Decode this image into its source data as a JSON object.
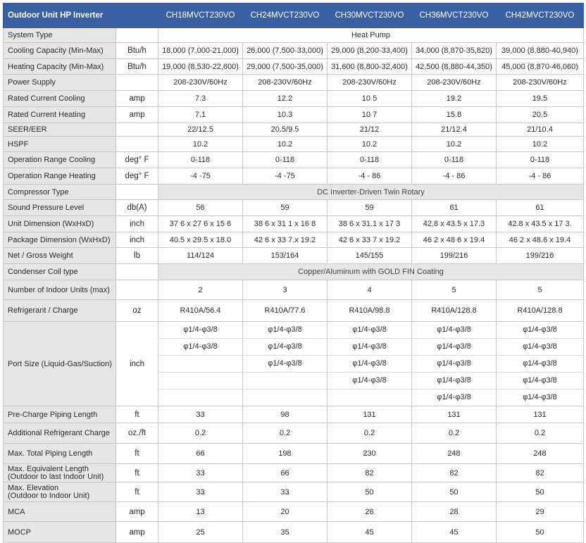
{
  "table": {
    "title": "Outdoor Unit HP Inverter",
    "models": [
      "CH18MVCT230VO",
      "CH24MVCT230VO",
      "CH30MVCT230VO",
      "CH36MVCT230VO",
      "CH42MVCT230VO"
    ],
    "rows": [
      {
        "label": "System Type",
        "unit": "",
        "span": "Heat Pump",
        "height": 21
      },
      {
        "label": "Cooling Capacity (Min-Max)",
        "unit": "Btu/h",
        "values": [
          "18,000 (7,000-21,000)",
          "26,000 (7,500-33,000)",
          "29,000 (8,200-33,400)",
          "34,000 (8,870-35,820)",
          "39,000 (8,880-40,940)"
        ],
        "height": 23
      },
      {
        "label": "Heating Capacity (Min-Max)",
        "unit": "Btu/h",
        "values": [
          "19,000 (8,530-22,600)",
          "29,000 (7,500-35,000)",
          "31,600 (8,800-32,400)",
          "42,500 (8,880-44,350)",
          "45,000 (8,870-46,060)"
        ],
        "height": 22
      },
      {
        "label": "Power Supply",
        "unit": "",
        "values": [
          "208-230V/60Hz",
          "208-230V/60Hz",
          "208-230V/60Hz",
          "208-230V/60Hz",
          "208-230V/60Hz"
        ],
        "height": 23
      },
      {
        "label": "Rated  Current  Cooling",
        "unit": "amp",
        "values": [
          "7.3",
          "12.2",
          "10 5",
          "19.2",
          "19.5"
        ],
        "height": 23
      },
      {
        "label": "Rated  Current  Heating",
        "unit": "amp",
        "values": [
          "7.1",
          "10.3",
          "10 7",
          "15.8",
          "20.5"
        ],
        "height": 23
      },
      {
        "label": "SEER/EER",
        "unit": "",
        "values": [
          "22/12.5",
          "20.5/9.5",
          "21/12",
          "21/12.4",
          "21/10.4"
        ],
        "height": 19
      },
      {
        "label": "HSPF",
        "unit": "",
        "values": [
          "10.2",
          "10.2",
          "10.2",
          "10.2",
          "10.2"
        ],
        "height": 22
      },
      {
        "label": "Operation Range  Cooling",
        "unit": "deg° F",
        "values": [
          "0-118",
          "0-118",
          "0-118",
          "0-118",
          "0-118"
        ],
        "height": 23
      },
      {
        "label": "Operation Range  Heating",
        "unit": "deg° F",
        "values": [
          "-4 -75",
          "-4 -75",
          "-4 - 86",
          "-4 - 86",
          "-4 - 86"
        ],
        "height": 23
      },
      {
        "label": "Compressor Type",
        "unit": "",
        "span": "DC Inverter-Driven Twin Rotary",
        "shaded": true,
        "height": 22
      },
      {
        "label": "Sound Pressure Level",
        "unit": "db(A)",
        "values": [
          "56",
          "59",
          "59",
          "61",
          "61"
        ],
        "height": 23
      },
      {
        "label": "Unit Dimension (WxHxD)",
        "unit": "inch",
        "values": [
          "37 6 x 27 6 x 15 6",
          "38 6 x 31 1 x 16 8",
          "38 6 x 31.1 x 17 3",
          "42.8 x 43.5 x 17.3",
          "42.8 x 43.5 x 17 3."
        ],
        "height": 23
      },
      {
        "label": "Package Dimension (WxHxD)",
        "unit": "inch",
        "values": [
          "40.5 x 29.5 x 18.0",
          "42 6 x 33 7.x 19.2",
          "42 6 x 33 7 x 19.2",
          "46 2 x 48 6 x 19.4",
          "46 2 x 48.6 x 19.4"
        ],
        "height": 22
      },
      {
        "label": "Net / Gross Weight",
        "unit": "lb",
        "values": [
          "114/124",
          "153/164",
          "145/155",
          "199/216",
          "199/216"
        ],
        "height": 23
      },
      {
        "label": "Condenser Coil type",
        "unit": "",
        "span": "Copper/Aluminum with GOLD FIN Coating",
        "shaded": true,
        "height": 23
      },
      {
        "label": "Number of Indoor Units (max)",
        "unit": "",
        "values": [
          "2",
          "3",
          "4",
          "5",
          "5"
        ],
        "height": 28
      },
      {
        "label": "Refrigerant / Charge",
        "unit": "oz",
        "values": [
          "R410A/56.4",
          "R410A/77.6",
          "R410A/98.8",
          "R410A/128.8",
          "R410A/128.8"
        ],
        "height": 31
      },
      {
        "label": "Port Size (Liquid-Gas/Suction)",
        "unit": "inch",
        "ports": [
          [
            "φ1/4-φ3/8",
            "φ1/4-φ3/8",
            "",
            "",
            ""
          ],
          [
            "φ1/4-φ3/8",
            "φ1/4-φ3/8",
            "φ1/4-φ3/8",
            "",
            ""
          ],
          [
            "φ1/4-φ3/8",
            "φ1/4-φ3/8",
            "φ1/4-φ3/8",
            "φ1/4-φ3/8",
            ""
          ],
          [
            "φ1/4-φ3/8",
            "φ1/4-φ3/8",
            "φ1/4-φ3/8",
            "φ1/4-φ3/8",
            "φ1/4-φ3/8"
          ],
          [
            "φ1/4-φ3/8",
            "φ1/4-φ3/8",
            "φ1/4-φ3/8",
            "φ1/4-φ3/8",
            "φ1/4-φ3/8"
          ]
        ],
        "height": 115
      },
      {
        "label": "Pre-Charge Piping Length",
        "unit": "ft",
        "values": [
          "33",
          "98",
          "131",
          "131",
          "131"
        ],
        "height": 24
      },
      {
        "label": "Additional Refrigerant Charge",
        "unit": "oz./ft",
        "values": [
          "0.2",
          "0.2",
          "0.2",
          "0.2",
          "0.2"
        ],
        "height": 29
      },
      {
        "label": "Max. Total Piping Length",
        "unit": "ft",
        "values": [
          "66",
          "198",
          "230",
          "248",
          "248"
        ],
        "height": 29
      },
      {
        "label": "Max. Equivalent Length\n(Outdoor to last Indoor Unit)",
        "unit": "ft",
        "values": [
          "33",
          "66",
          "82",
          "82",
          "82"
        ],
        "height": 26,
        "twoLine": true
      },
      {
        "label": "Max. Elevation\n(Outdoor to Indoor Unit)",
        "unit": "ft",
        "values": [
          "33",
          "33",
          "50",
          "50",
          "50"
        ],
        "height": 28,
        "twoLine": true
      },
      {
        "label": "MCA",
        "unit": "amp",
        "values": [
          "13",
          "20",
          "26",
          "28",
          "29"
        ],
        "height": 28
      },
      {
        "label": "MOCP",
        "unit": "amp",
        "values": [
          "25",
          "35",
          "45",
          "45",
          "50"
        ],
        "height": 30
      }
    ]
  }
}
